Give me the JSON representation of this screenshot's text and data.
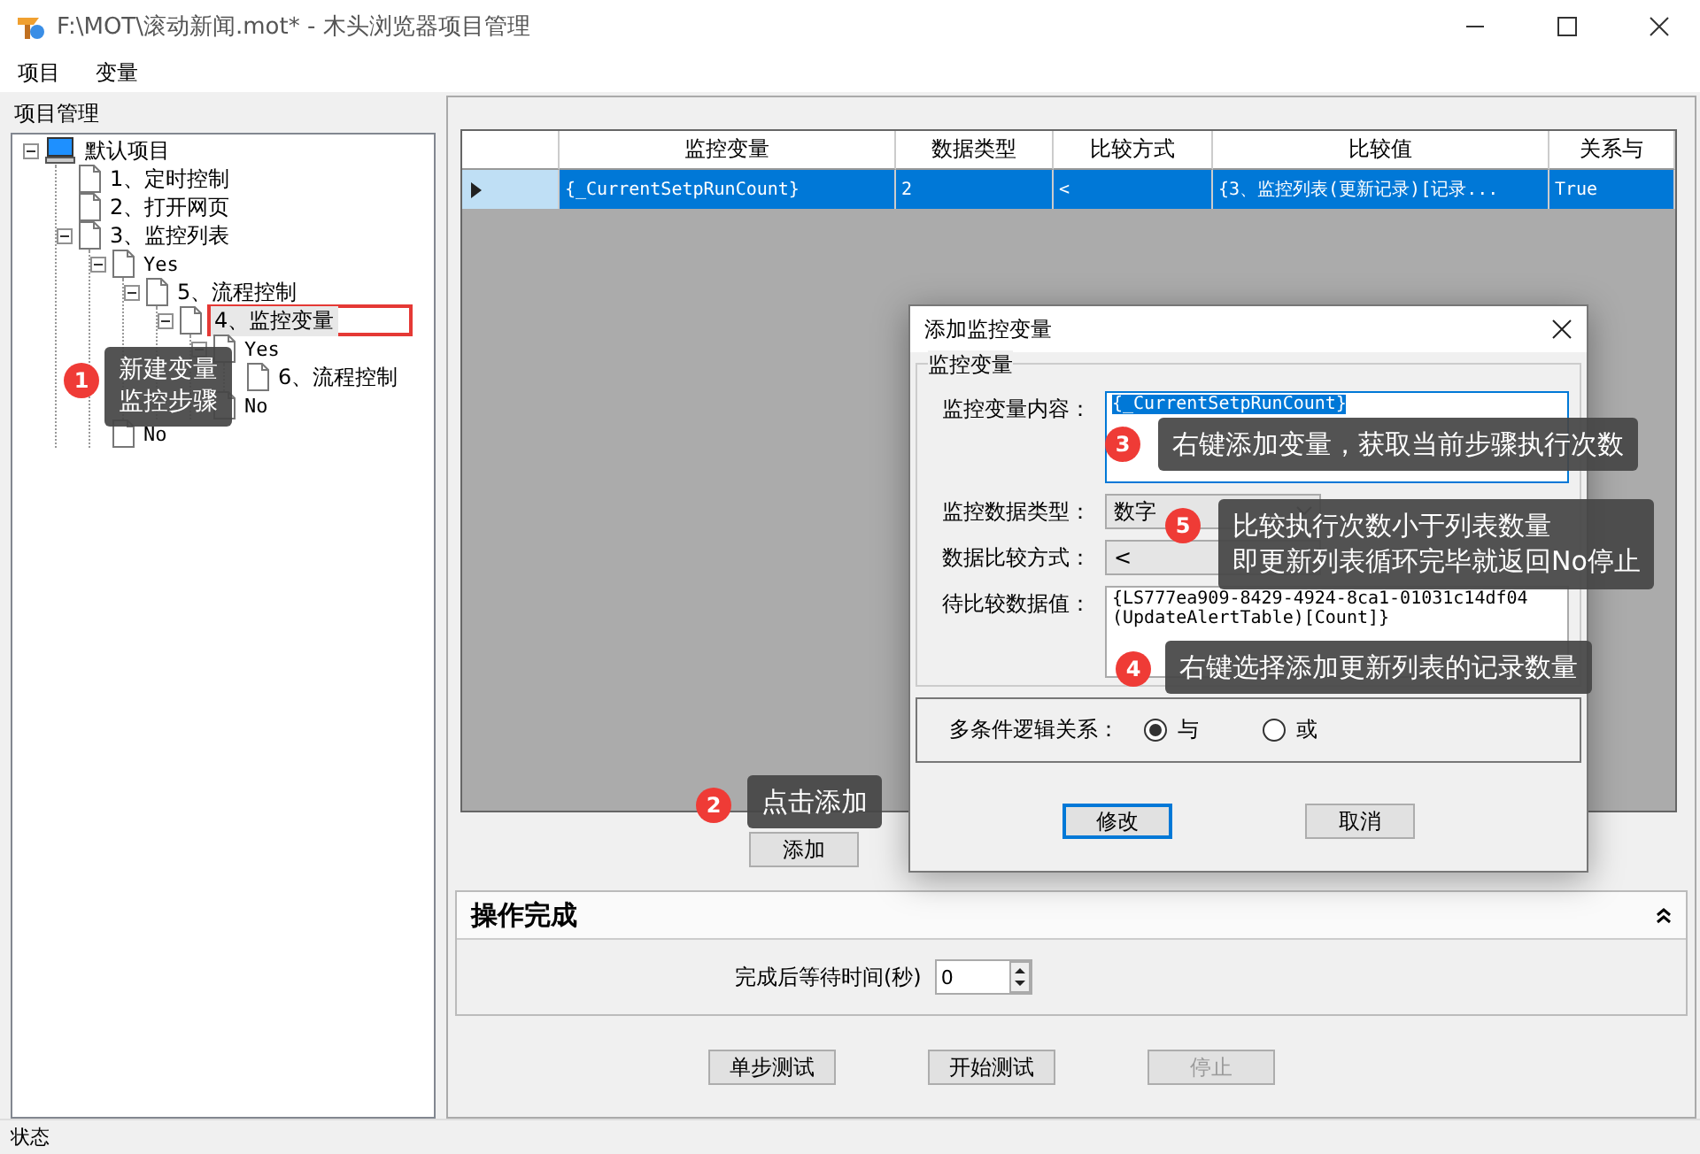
{
  "window": {
    "title": "F:\\MOT\\滚动新闻.mot* - 木头浏览器项目管理"
  },
  "menu": [
    "项目",
    "变量"
  ],
  "project_panel": {
    "title": "项目管理",
    "tree": [
      {
        "label": "默认项目",
        "kind": "project",
        "selected": false,
        "expanded": true,
        "children": [
          {
            "label": "1、定时控制",
            "kind": "step",
            "selected": false
          },
          {
            "label": "2、打开网页",
            "kind": "step",
            "selected": false
          },
          {
            "label": "3、监控列表",
            "kind": "step",
            "selected": false,
            "expanded": true,
            "children": [
              {
                "label": "Yes",
                "kind": "branch",
                "selected": false,
                "expanded": true,
                "children": [
                  {
                    "label": "5、流程控制",
                    "kind": "step",
                    "selected": false,
                    "expanded": true,
                    "children": [
                      {
                        "label": "4、监控变量",
                        "kind": "step",
                        "selected": true,
                        "expanded": true,
                        "children": [
                          {
                            "label": "Yes",
                            "kind": "branch",
                            "selected": false,
                            "expanded": true,
                            "children": [
                              {
                                "label": "6、流程控制",
                                "kind": "step",
                                "selected": false
                              }
                            ]
                          },
                          {
                            "label": "No",
                            "kind": "branch",
                            "selected": false
                          }
                        ]
                      }
                    ]
                  }
                ]
              },
              {
                "label": "No",
                "kind": "branch",
                "selected": false
              }
            ]
          }
        ]
      }
    ]
  },
  "grid": {
    "columns": [
      "监控变量",
      "数据类型",
      "比较方式",
      "比较值",
      "关系与"
    ],
    "rows": [
      {
        "selected": true,
        "cells": [
          "{_CurrentSetpRunCount}",
          "2",
          "<",
          "{3、监控列表(更新记录)[记录...",
          "True"
        ]
      }
    ]
  },
  "add_button": "添加",
  "operation_section": {
    "title": "操作完成",
    "expanded": true,
    "wait_label": "完成后等待时间(秒)",
    "wait_value": "0"
  },
  "buttons": [
    {
      "label": "单步测试",
      "disabled": false
    },
    {
      "label": "开始测试",
      "disabled": false
    },
    {
      "label": "停止",
      "disabled": true
    }
  ],
  "status_bar": "状态",
  "dialog": {
    "title": "添加监控变量",
    "group": "监控变量",
    "fields": [
      {
        "kind": "textarea",
        "label": "监控变量内容：",
        "value": "{_CurrentSetpRunCount}",
        "focused": true
      },
      {
        "kind": "select",
        "label": "监控数据类型：",
        "value": "数字",
        "focused": false
      },
      {
        "kind": "select",
        "label": "数据比较方式：",
        "value": "<",
        "focused": false
      },
      {
        "kind": "textarea",
        "label": "待比较数据值：",
        "value": "{LS777ea909-8429-4924-8ca1-01031c14df04\n(UpdateAlertTable)[Count]}",
        "focused": false
      }
    ],
    "logic": {
      "label": "多条件逻辑关系：",
      "options": [
        {
          "label": "与",
          "selected": true
        },
        {
          "label": "或",
          "selected": false
        }
      ]
    },
    "buttons": [
      {
        "label": "修改",
        "focused": true
      },
      {
        "label": "取消",
        "focused": false
      }
    ]
  },
  "callouts": [
    {
      "number": "1",
      "lines": [
        "新建变量监控步骤"
      ]
    },
    {
      "number": "2",
      "lines": [
        "点击添加"
      ]
    },
    {
      "number": "3",
      "lines": [
        "右键添加变量，获取当前步骤执行次数"
      ]
    },
    {
      "number": "5",
      "lines": [
        "比较执行次数小于列表数量",
        "即更新列表循环完毕就返回No停止"
      ]
    },
    {
      "number": "4",
      "lines": [
        "右键选择添加更新列表的记录数量"
      ]
    }
  ]
}
